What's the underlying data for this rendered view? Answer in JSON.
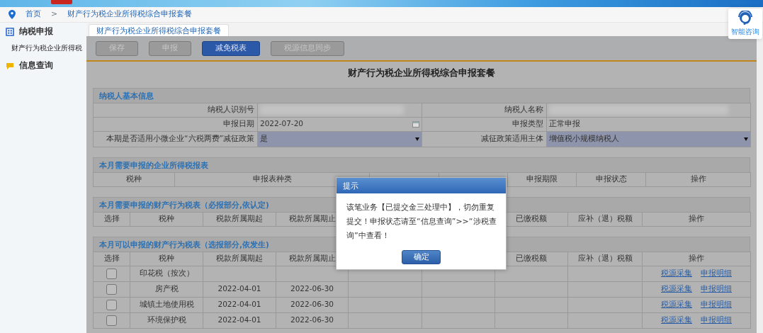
{
  "breadcrumb": [
    "首页",
    ">",
    "财产行为税企业所得税综合申报套餐"
  ],
  "help_button": {
    "label": "智能咨询"
  },
  "sidebar": {
    "items": [
      {
        "label": "纳税申报",
        "children": [
          {
            "label": "财产行为税企业所得税",
            "selected": true
          }
        ]
      },
      {
        "label": "信息查询"
      }
    ]
  },
  "tabs": [
    {
      "label": "财产行为税企业所得税综合申报套餐",
      "selected": true
    }
  ],
  "toolbar": [
    {
      "label": "保存",
      "disabled": true
    },
    {
      "label": "申报",
      "disabled": true
    },
    {
      "label": "减免税表",
      "disabled": false
    },
    {
      "label": "税源信息同步",
      "disabled": true
    }
  ],
  "form_title": "财产行为税企业所得税综合申报套餐",
  "basic_info": {
    "title": "纳税人基本信息",
    "fields": [
      {
        "label": "纳税人识别号",
        "kind": "blurred"
      },
      {
        "label": "纳税人名称",
        "kind": "blurred"
      },
      {
        "label": "申报日期",
        "kind": "date",
        "value": "2022-07-20"
      },
      {
        "label": "申报类型",
        "kind": "text",
        "value": "正常申报"
      },
      {
        "label": "本期是否适用小微企业“六税两费”减征政策",
        "kind": "select",
        "value": "是"
      },
      {
        "label": "减征政策适用主体",
        "kind": "select",
        "value": "增值税小规模纳税人"
      }
    ]
  },
  "income_tax_section": {
    "title": "本月需要申报的企业所得税报表",
    "columns": [
      "税种",
      "申报表种类",
      null,
      null,
      "申报期限",
      "申报状态",
      "操作"
    ]
  },
  "required_section": {
    "title": "本月需要申报的财产行为税表（必报部分,依认定)",
    "columns": [
      "选择",
      "税种",
      "税款所属期起",
      "税款所属期止",
      null,
      null,
      "已缴税额",
      "应补（退）税额",
      "操作"
    ]
  },
  "optional_section": {
    "title": "本月可以申报的财产行为税表（选报部分,依发生)",
    "columns": [
      "选择",
      "税种",
      "税款所属期起",
      "税款所属期止",
      null,
      null,
      "已缴税额",
      "应补（退）税额",
      "操作"
    ],
    "rows": [
      {
        "checked": false,
        "tax": "印花税（按次）",
        "actions": [
          "税源采集",
          "申报明细"
        ]
      },
      {
        "checked": false,
        "tax": "房产税",
        "start": "2022-04-01",
        "end": "2022-06-30",
        "actions": [
          "税源采集",
          "申报明细"
        ]
      },
      {
        "checked": false,
        "tax": "城镇土地使用税",
        "start": "2022-04-01",
        "end": "2022-06-30",
        "actions": [
          "税源采集",
          "申报明细"
        ]
      },
      {
        "checked": false,
        "tax": "环境保护税",
        "start": "2022-04-01",
        "end": "2022-06-30",
        "actions": [
          "税源采集",
          "申报明细"
        ]
      }
    ]
  },
  "dialog": {
    "title": "提示",
    "message": "该笔业务【已提交金三处理中】，切勿重复提交！申报状态请至“信息查询”>>“涉税查询”中查看！",
    "button": "确定"
  }
}
